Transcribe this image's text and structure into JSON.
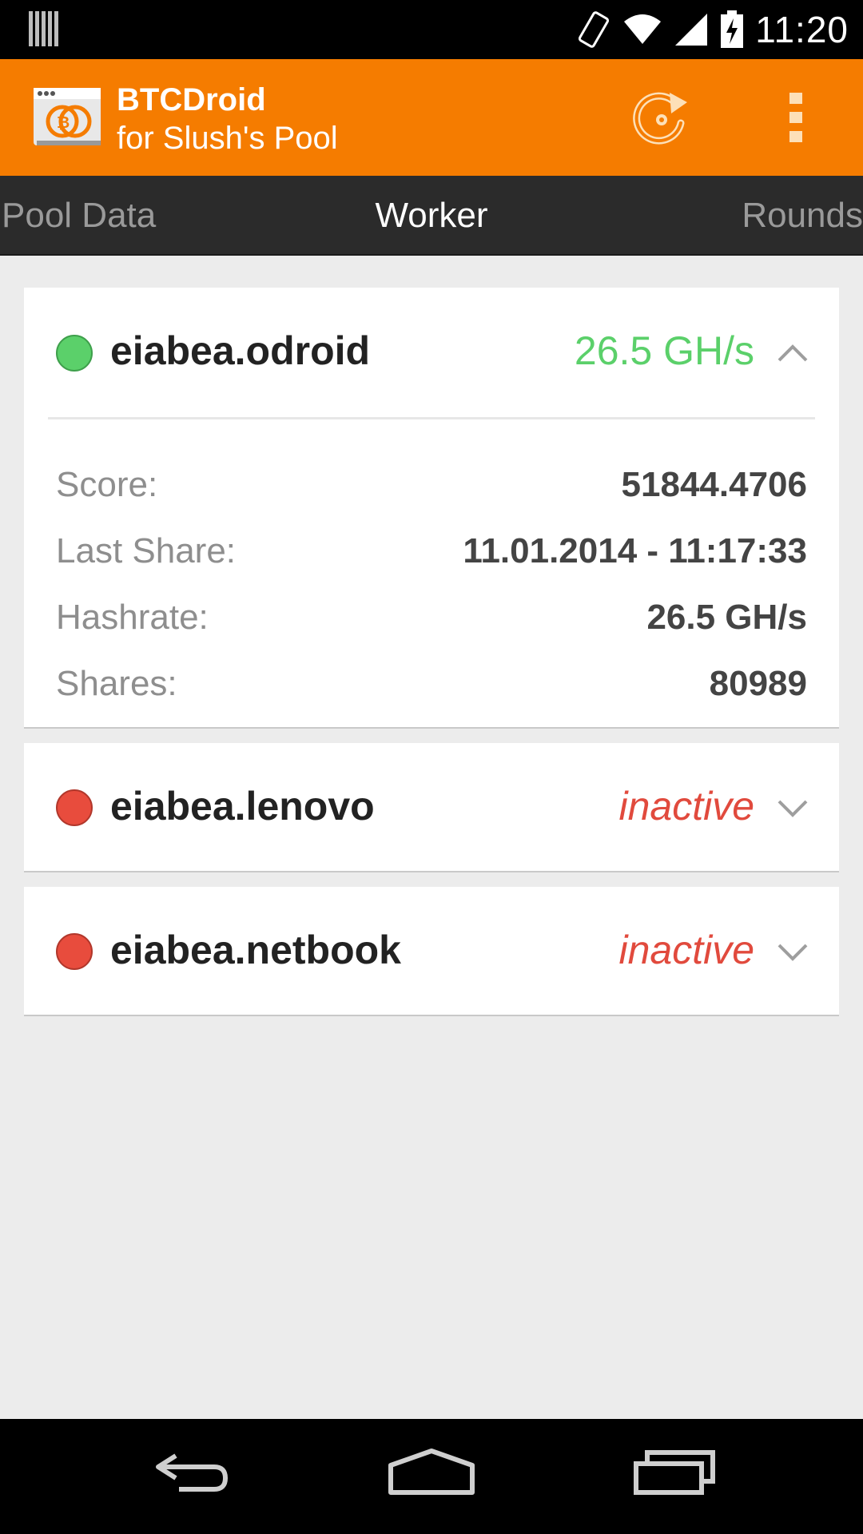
{
  "status_bar": {
    "time": "11:20"
  },
  "app_bar": {
    "title": "BTCDroid",
    "subtitle": "for Slush's Pool",
    "accent_color": "#f57c00"
  },
  "tabs": [
    {
      "label": "Pool Data",
      "selected": false
    },
    {
      "label": "Worker",
      "selected": true
    },
    {
      "label": "Rounds",
      "selected": false
    }
  ],
  "workers": [
    {
      "name": "eiabea.odroid",
      "status": "active",
      "rate": "26.5 GH/s",
      "expanded": true,
      "details": [
        {
          "label": "Score:",
          "value": "51844.4706"
        },
        {
          "label": "Last Share:",
          "value": "11.01.2014 - 11:17:33"
        },
        {
          "label": "Hashrate:",
          "value": "26.5 GH/s"
        },
        {
          "label": "Shares:",
          "value": "80989"
        }
      ]
    },
    {
      "name": "eiabea.lenovo",
      "status": "inactive",
      "rate": "inactive",
      "expanded": false
    },
    {
      "name": "eiabea.netbook",
      "status": "inactive",
      "rate": "inactive",
      "expanded": false
    }
  ],
  "icons": {
    "status_left": "barcode-icon",
    "vibrate": "vibrate-icon",
    "wifi": "wifi-icon",
    "signal": "signal-icon",
    "battery": "battery-charging-icon",
    "refresh": "refresh-icon",
    "overflow": "overflow-menu-icon",
    "back": "back-icon",
    "home": "home-icon",
    "recents": "recents-icon"
  }
}
